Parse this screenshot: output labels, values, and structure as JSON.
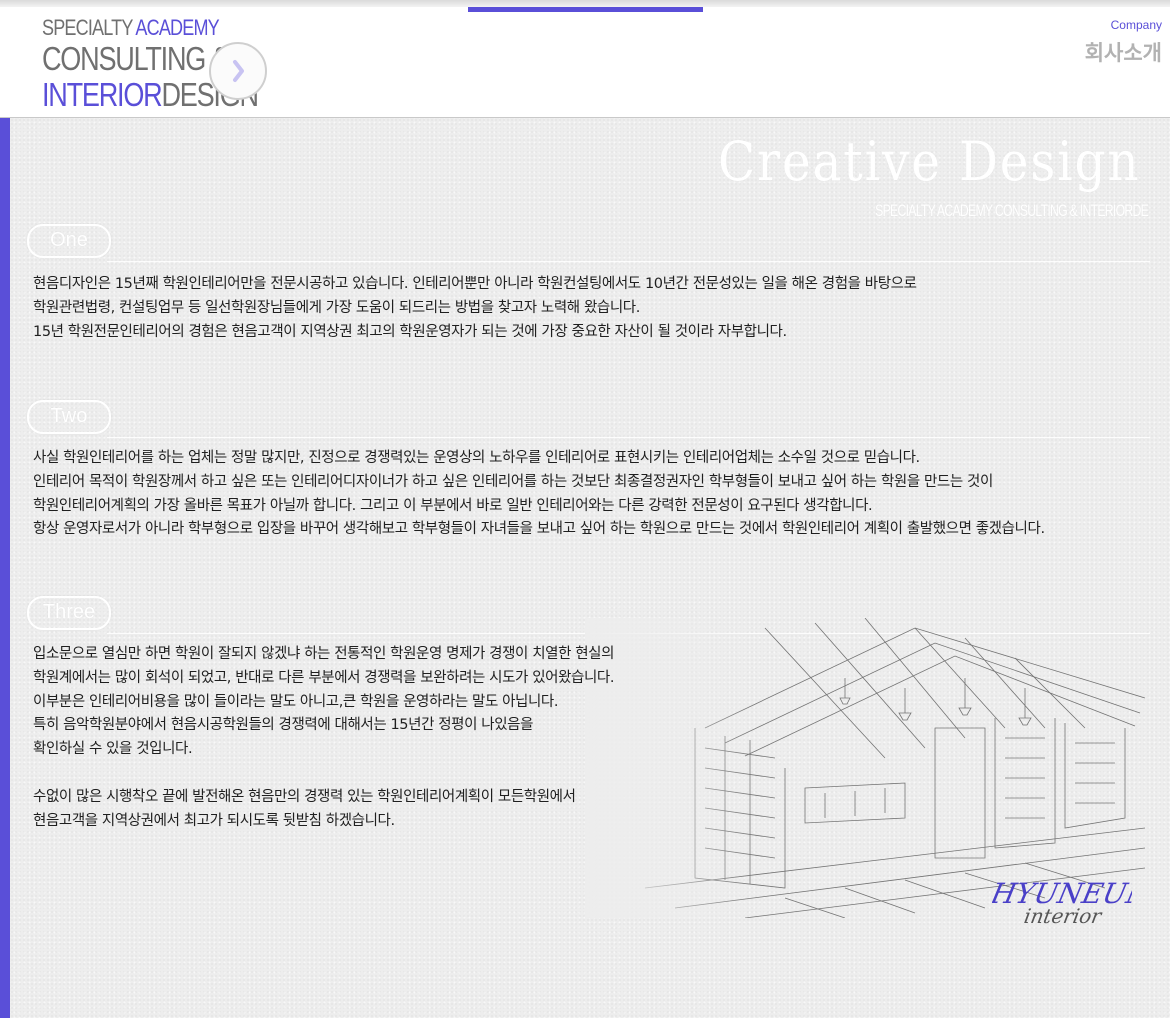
{
  "header": {
    "logo": {
      "line1_a": "SPECIALTY",
      "line1_b": "ACADEMY",
      "line2": "CONSULTING &",
      "line3_a": "INTERIOR",
      "line3_b": "DESIGN"
    },
    "next_button_icon": "chevron-right-icon",
    "company_label_en": "Company",
    "company_label_ko": "회사소개"
  },
  "hero": {
    "title": "Creative Design",
    "subtitle": "SPECIALTY ACADEMY CONSULTING & INTERIORDE"
  },
  "sections": [
    {
      "label": "One",
      "lines": [
        " 현음디자인은 15년째 학원인테리어만을 전문시공하고 있습니다. 인테리어뿐만 아니라 학원컨설팅에서도 10년간 전문성있는 일을 해온 경험을 바탕으로",
        "학원관련법령, 컨설팅업무 등 일선학원장님들에게 가장 도움이 되드리는 방법을 찾고자 노력해 왔습니다.",
        "15년 학원전문인테리어의 경험은 현음고객이 지역상권 최고의 학원운영자가 되는 것에 가장 중요한 자산이 될 것이라 자부합니다."
      ]
    },
    {
      "label": "Two",
      "lines": [
        "사실 학원인테리어를 하는 업체는 정말 많지만, 진정으로 경쟁력있는 운영상의 노하우를 인테리어로 표현시키는 인테리어업체는 소수일 것으로 믿습니다.",
        "인테리어 목적이 학원장께서 하고 싶은 또는 인테리어디자이너가 하고 싶은 인테리어를 하는 것보단 최종결정권자인 학부형들이 보내고 싶어 하는 학원을 만드는 것이",
        "학원인테리어계획의 가장 올바른 목표가 아닐까 합니다. 그리고 이 부분에서 바로 일반 인테리어와는 다른 강력한 전문성이 요구된다 생각합니다.",
        "항상 운영자로서가 아니라 학부형으로 입장을  바꾸어  생각해보고 학부형들이 자녀들을 보내고 싶어 하는 학원으로 만드는 것에서 학원인테리어 계획이 출발했으면 좋겠습니다."
      ]
    },
    {
      "label": "Three",
      "lines_a": [
        "입소문으로 열심만 하면 학원이 잘되지 않겠냐 하는 전통적인 학원운영 명제가 경쟁이 치열한 현실의",
        "학원계에서는 많이 회석이 되었고, 반대로 다른 부분에서 경쟁력을 보완하려는 시도가 있어왔습니다.",
        "이부분은 인테리어비용을 많이 들이라는 말도 아니고,큰 학원을 운영하라는 말도 아닙니다.",
        "특히 음악학원분야에서 현음시공학원들의 경쟁력에 대해서는 15년간 정평이 나있음을",
        "확인하실 수 있을 것입니다."
      ],
      "lines_b": [
        "수없이 많은 시행착오 끝에 발전해온 현음만의 경쟁력 있는 학원인테리어계획이 모든학원에서",
        "현음고객을 지역상권에서 최고가 되시도록 뒷받침 하겠습니다."
      ]
    }
  ],
  "illustration": {
    "image": "interior-sketch",
    "signature_line1": "HYUNEUM",
    "signature_line2": "interior"
  },
  "colors": {
    "accent": "#5a4fd8",
    "text": "#1f1f1f",
    "muted": "#b2b2b2"
  }
}
